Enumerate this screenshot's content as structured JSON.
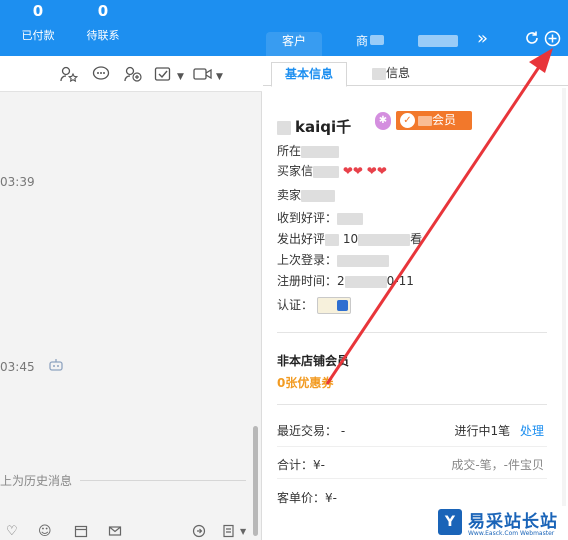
{
  "header": {
    "stats": [
      {
        "value": "0",
        "label": "已付款"
      },
      {
        "value": "0",
        "label": "待联系"
      }
    ],
    "tabs": [
      {
        "label": "客户"
      },
      {
        "label": "商"
      }
    ],
    "more_icon": "chevron-double-right-icon",
    "refresh_icon": "refresh-icon",
    "add_icon": "add-circle-icon"
  },
  "chat": {
    "toolbar_icons": [
      "star-user-icon",
      "chat-bubble-icon",
      "add-user-icon",
      "confirm-icon",
      "video-icon"
    ],
    "timestamps": [
      "03:39",
      "03:45"
    ],
    "system_message": "上为历史消息",
    "bottom_icons": [
      "heart-icon",
      "smile-icon",
      "calendar-icon",
      "mail-icon",
      "forward-icon",
      "list-icon"
    ]
  },
  "info": {
    "tabs": [
      {
        "label": "基本信息"
      },
      {
        "label": "信息"
      }
    ],
    "name": "kaiqi千",
    "vip_label": "会员",
    "fields": {
      "location": "所在",
      "buyer_credit": "买家信",
      "seller_credit": "卖家",
      "received_good": "收到好评：",
      "given_good": "发出好评",
      "given_good_num": "10",
      "given_good_link": "看",
      "last_login": "上次登录：",
      "register_label": "注册时间：",
      "register_prefix": "2",
      "register_suffix": "0-11",
      "cert_label": "认证："
    },
    "store_member": "非本店铺会员",
    "coupons": "0张优惠券",
    "recent_trade_label": "最近交易：",
    "recent_trade_value": "-",
    "in_progress": "进行中1笔",
    "handle_link": "处理",
    "total_label": "合计：",
    "total_value": "¥-",
    "deal_summary": "成交-笔，-件宝贝",
    "unit_price_label": "客单价：",
    "unit_price_value": "¥-"
  },
  "watermark": {
    "logo": "Y",
    "text": "易采站长站",
    "sub": "Www.Easck.Com Webmaster"
  },
  "colors": {
    "header_blue": "#1d8ff0",
    "vip_orange": "#f2782b",
    "coupon_orange": "#f29b22",
    "arrow_red": "#e8353a"
  }
}
